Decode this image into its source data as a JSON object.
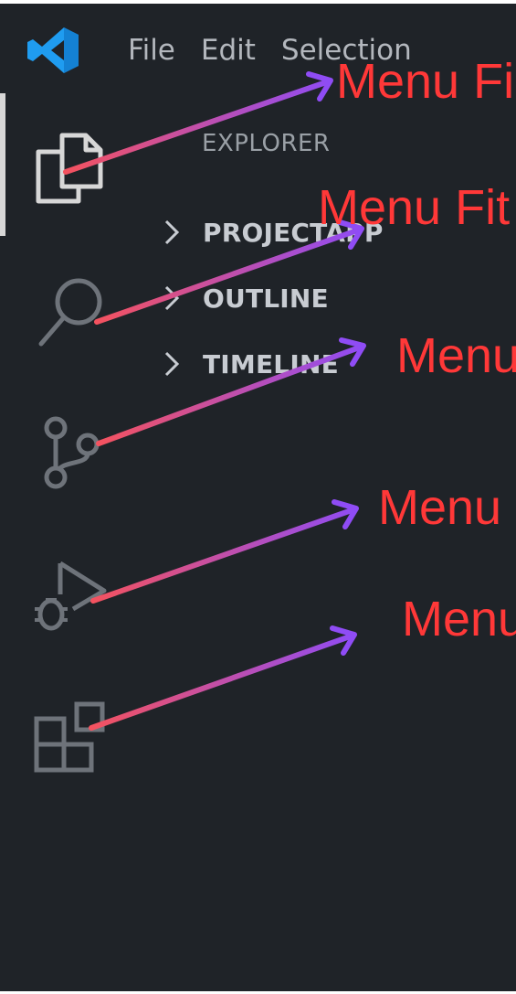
{
  "menu": {
    "items": [
      "File",
      "Edit",
      "Selection"
    ]
  },
  "sidebar": {
    "title": "EXPLORER",
    "sections": [
      {
        "label": "PROJECTAPP",
        "icon": "chevron-right-icon"
      },
      {
        "label": "OUTLINE",
        "icon": "chevron-right-icon"
      },
      {
        "label": "TIMELINE",
        "icon": "chevron-right-icon"
      }
    ]
  },
  "activity_bar": {
    "items": [
      {
        "name": "explorer",
        "icon": "files-icon",
        "active": true
      },
      {
        "name": "search",
        "icon": "search-icon",
        "active": false
      },
      {
        "name": "source-control",
        "icon": "source-control-icon",
        "active": false
      },
      {
        "name": "run-and-debug",
        "icon": "run-debug-icon",
        "active": false
      },
      {
        "name": "extensions",
        "icon": "extensions-icon",
        "active": false
      }
    ]
  },
  "annotations": [
    {
      "label": "Menu Fi"
    },
    {
      "label": "Menu Fit"
    },
    {
      "label": "Menu"
    },
    {
      "label": "Menu"
    },
    {
      "label": "Menu"
    }
  ],
  "colors": {
    "background": "#1f2328",
    "menu_text": "#b3b7bd",
    "section_text": "#c8ccd2",
    "title_text": "#9aa0a6",
    "icon": "#6e737a",
    "icon_active": "#d7d7d7",
    "vscode_blue": "#1f9cf0",
    "annotation_text": "#ff3838",
    "arrow_start": "#f4525f",
    "arrow_end": "#8f4cf5"
  }
}
